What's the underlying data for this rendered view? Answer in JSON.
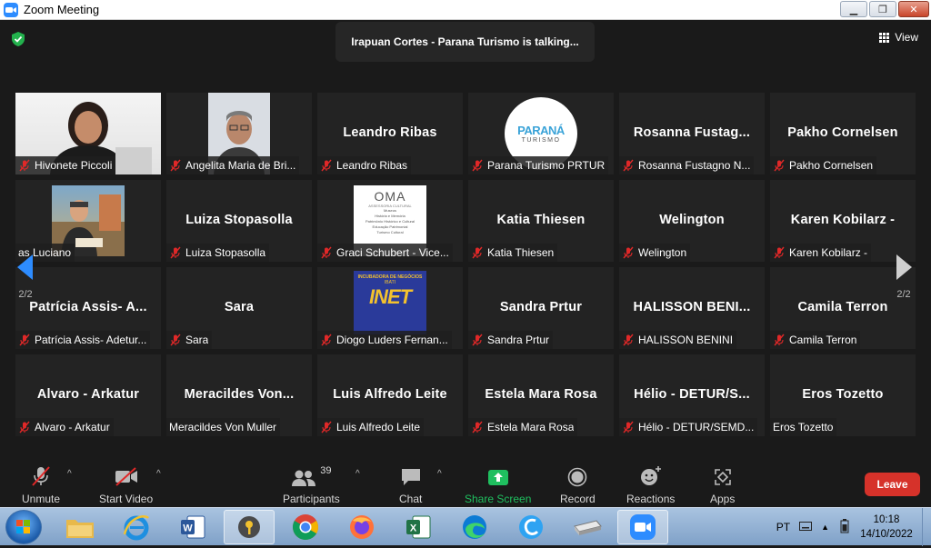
{
  "window": {
    "title": "Zoom Meeting",
    "min": "▁",
    "max": "❐",
    "close": "✕"
  },
  "talking_banner": "Irapuan Cortes - Parana Turismo  is talking...",
  "view_label": "View",
  "page_indicator": "2/2",
  "tiles": [
    {
      "big": "",
      "label": "Hivonete Piccoli",
      "muted": true,
      "photo": "woman"
    },
    {
      "big": "",
      "label": "Angelita Maria de Bri...",
      "muted": true,
      "photo": "man-glasses"
    },
    {
      "big": "Leandro Ribas",
      "label": "Leandro Ribas",
      "muted": true
    },
    {
      "big": "",
      "label": "Parana Turismo PRTUR",
      "muted": true,
      "photo": "parana-logo"
    },
    {
      "big": "Rosanna  Fustag...",
      "label": "Rosanna Fustagno N...",
      "muted": true
    },
    {
      "big": "Pakho Cornelsen",
      "label": "Pakho Cornelsen",
      "muted": true
    },
    {
      "big": "",
      "label": "as Luciano",
      "muted": false,
      "photo": "man-outdoor"
    },
    {
      "big": "Luiza Stopasolla",
      "label": "Luiza Stopasolla",
      "muted": true
    },
    {
      "big": "",
      "label": "Graci Schubert - Vice...",
      "muted": true,
      "photo": "oma-logo"
    },
    {
      "big": "Katia Thiesen",
      "label": "Katia Thiesen",
      "muted": true
    },
    {
      "big": "Welington",
      "label": "Welington",
      "muted": true
    },
    {
      "big": "Karen Kobilarz -",
      "label": "Karen Kobilarz -",
      "muted": true
    },
    {
      "big": "Patrícia Assis- A...",
      "label": "Patrícia Assis- Adetur...",
      "muted": true
    },
    {
      "big": "Sara",
      "label": "Sara",
      "muted": true
    },
    {
      "big": "",
      "label": "Diogo Luders Fernan...",
      "muted": true,
      "photo": "inet-logo"
    },
    {
      "big": "Sandra Prtur",
      "label": "Sandra Prtur",
      "muted": true
    },
    {
      "big": "HALISSON  BENI...",
      "label": "HALISSON BENINI",
      "muted": true
    },
    {
      "big": "Camila Terron",
      "label": "Camila Terron",
      "muted": true
    },
    {
      "big": "Alvaro - Arkatur",
      "label": "Alvaro - Arkatur",
      "muted": true
    },
    {
      "big": "Meracildes  Von...",
      "label": "Meracildes Von Muller",
      "muted": false
    },
    {
      "big": "Luis Alfredo Leite",
      "label": "Luis Alfredo Leite",
      "muted": true
    },
    {
      "big": "Estela Mara Rosa",
      "label": "Estela Mara Rosa",
      "muted": true
    },
    {
      "big": "Hélio  -  DETUR/S...",
      "label": "Hélio - DETUR/SEMD...",
      "muted": true
    },
    {
      "big": "Eros Tozetto",
      "label": "Eros Tozetto",
      "muted": false
    }
  ],
  "logos": {
    "parana_top": "PARANÁ",
    "parana_bottom": "TURISMO",
    "oma_title": "OMA",
    "oma_sub": "ASSESSORIA CULTURAL",
    "oma_lines": [
      "Museus",
      "História e Memória",
      "Patrimônio Histórico e Cultural",
      "Educação Patrimonial",
      "Turismo Cultural"
    ],
    "inet_top": "INCUBADORA DE NEGÓCIOS",
    "inet_sub": "IBATI",
    "inet_main": "INET"
  },
  "toolbar": {
    "unmute": "Unmute",
    "start_video": "Start Video",
    "participants": "Participants",
    "participants_count": "39",
    "chat": "Chat",
    "share_screen": "Share Screen",
    "record": "Record",
    "reactions": "Reactions",
    "apps": "Apps",
    "leave": "Leave",
    "caret": "^"
  },
  "taskbar": {
    "lang": "PT",
    "time": "10:18",
    "date": "14/10/2022"
  },
  "colors": {
    "share_green": "#1fbf5f",
    "leave_red": "#d6322a",
    "muted_red": "#e02828",
    "accent_blue": "#2d8cff"
  }
}
